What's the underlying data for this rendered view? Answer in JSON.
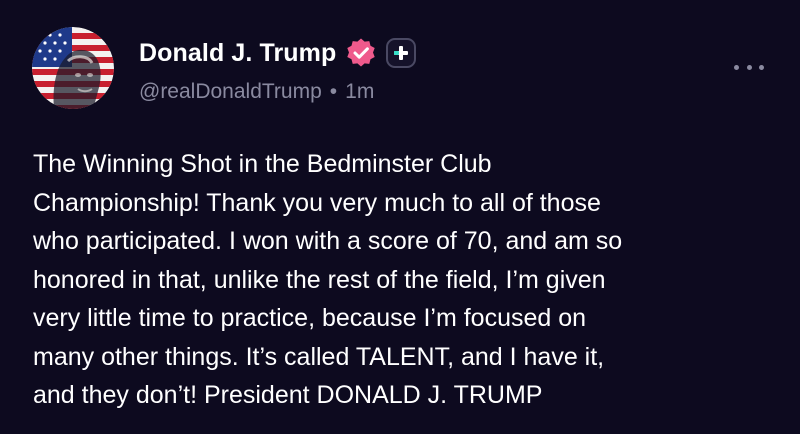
{
  "post": {
    "author": {
      "display_name": "Donald J. Trump",
      "handle": "@realDonaldTrump",
      "verified_icon": "verified-badge-icon",
      "plus_icon": "plus-badge-icon",
      "avatar_icon": "avatar-american-flag-portrait"
    },
    "timestamp": "1m",
    "separator": "•",
    "more_icon": "more-options-icon",
    "body_lines": [
      "The Winning Shot in the Bedminster Club",
      "Championship! Thank you very much to all of those",
      "who participated. I won with a score of 70, and am so",
      "honored in that, unlike the rest of the field, I’m given",
      "very little time to practice, because I’m focused on",
      "many other things. It’s called TALENT, and I have it,",
      "and they don’t! President DONALD J. TRUMP"
    ]
  },
  "colors": {
    "background": "#0d0a1f",
    "text_primary": "#ffffff",
    "text_secondary": "#8a8aa0",
    "verified_badge": "#ef5a8c",
    "plus_accent": "#36e0c8"
  }
}
